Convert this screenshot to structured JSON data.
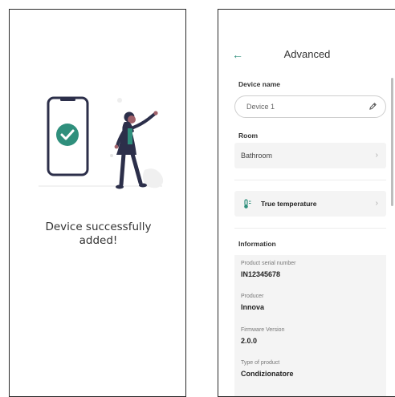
{
  "success_screen": {
    "message_line1": "Device successfully",
    "message_line2": "added!",
    "check_icon": "check-circle-icon",
    "accent_color": "#2f8f7c"
  },
  "advanced_screen": {
    "back_icon": "arrow-left-icon",
    "title": "Advanced",
    "device_name_label": "Device name",
    "device_name_value": "Device 1",
    "room_label": "Room",
    "room_value": "Bathroom",
    "true_temperature_label": "True temperature",
    "information_label": "Information",
    "info": [
      {
        "key": "Product serial number",
        "value": "IN12345678"
      },
      {
        "key": "Producer",
        "value": "Innova"
      },
      {
        "key": "Firmware Version",
        "value": "2.0.0"
      },
      {
        "key": "Type of product",
        "value": "Condizionatore"
      }
    ]
  }
}
